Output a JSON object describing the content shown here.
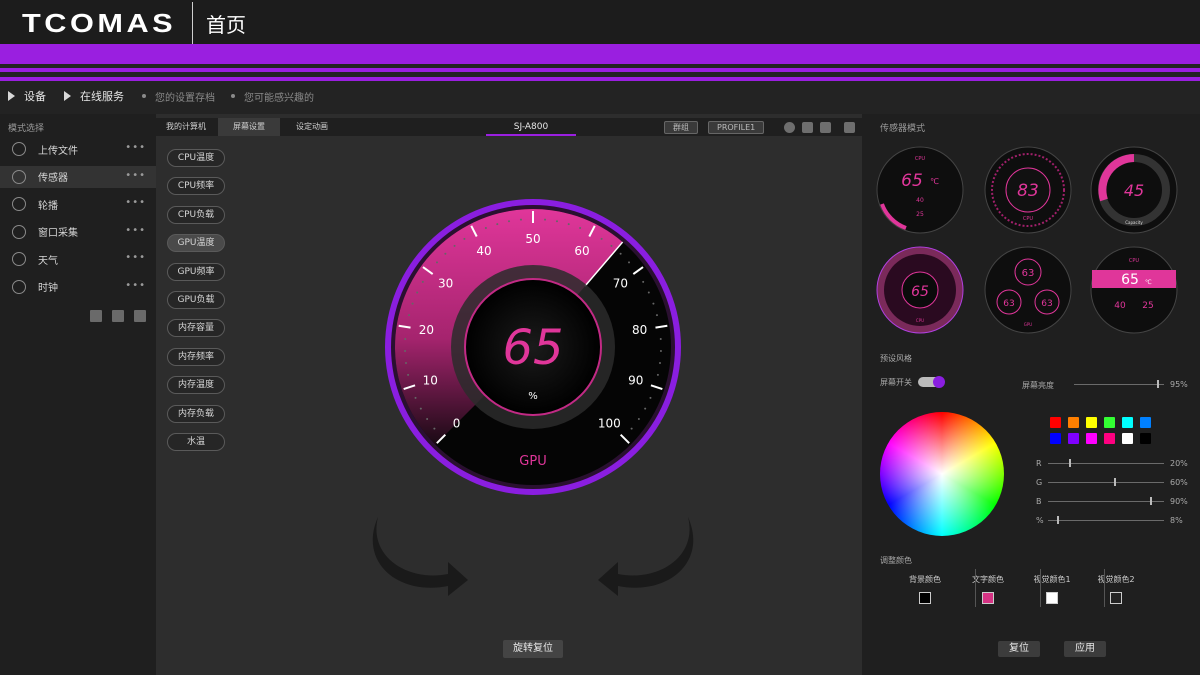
{
  "header": {
    "logo": "TCOMAS",
    "title": "首页"
  },
  "breadcrumb": {
    "device": "设备",
    "online": "在线服务",
    "saved": "您的设置存档",
    "interest": "您可能感兴趣的"
  },
  "sidebar": {
    "heading": "模式选择",
    "items": [
      {
        "label": "上传文件",
        "icon": "upload-icon"
      },
      {
        "label": "传感器",
        "icon": "sensor-icon"
      },
      {
        "label": "轮播",
        "icon": "carousel-icon"
      },
      {
        "label": "窗口采集",
        "icon": "window-capture-icon"
      },
      {
        "label": "天气",
        "icon": "weather-icon"
      },
      {
        "label": "时钟",
        "icon": "clock-icon"
      }
    ],
    "more": "•••"
  },
  "center": {
    "tabs": [
      "我的计算机",
      "屏幕设置",
      "设定动画"
    ],
    "device": "SJ-A800",
    "group_btn": "群组",
    "profile_btn": "PROFILE1",
    "sensors": [
      "CPU温度",
      "CPU频率",
      "CPU负载",
      "GPU温度",
      "GPU频率",
      "GPU负载",
      "内存容量",
      "内存频率",
      "内存温度",
      "内存负载",
      "水温"
    ],
    "gauge": {
      "value": "65",
      "unit": "%",
      "label": "GPU",
      "ticks": [
        "0",
        "10",
        "20",
        "30",
        "40",
        "50",
        "60",
        "70",
        "80",
        "90",
        "100"
      ],
      "fill_fraction": 0.65
    },
    "rotate_btn": "旋转复位"
  },
  "right": {
    "sensor_mode": "传感器模式",
    "thumbs": [
      {
        "big": "65",
        "unit": "℃",
        "top": "CPU",
        "a": "40",
        "b": "25"
      },
      {
        "big": "83",
        "unit": "",
        "top": "",
        "bottom": "CPU"
      },
      {
        "big": "45",
        "unit": "",
        "bottom": "Capacity"
      },
      {
        "big": "65",
        "unit": "",
        "bottom": "CPU"
      },
      {
        "big": "63",
        "small1": "63",
        "small2": "63",
        "bottom": "GPU"
      },
      {
        "big": "65",
        "unit": "℃",
        "top": "CPU",
        "a": "40",
        "b": "25"
      }
    ],
    "preset_style": "预设风格",
    "screen_switch": "屏幕开关",
    "brightness": "屏幕亮度",
    "brightness_value": "95%",
    "rgb": [
      {
        "label": "R",
        "value": "20%"
      },
      {
        "label": "G",
        "value": "60%"
      },
      {
        "label": "B",
        "value": "90%"
      },
      {
        "label": "%",
        "value": "8%"
      }
    ],
    "swatches": [
      "#ff0000",
      "#ff7f00",
      "#ffff00",
      "#33ff33",
      "#00ffff",
      "#0080ff",
      "#0000ff",
      "#7f00ff",
      "#ff00ff",
      "#ff0080",
      "#ffffff",
      "#000000"
    ],
    "adjust_colors": "调整颜色",
    "color_labels": [
      "背景颜色",
      "文字颜色",
      "视觉颜色1",
      "视觉颜色2"
    ],
    "color_values": [
      "#000000",
      "#d63384",
      "#ffffff",
      "#222222"
    ],
    "reset_btn": "复位",
    "apply_btn": "应用"
  },
  "colors": {
    "accent": "#9a1fe0",
    "pink": "#e0369a"
  }
}
